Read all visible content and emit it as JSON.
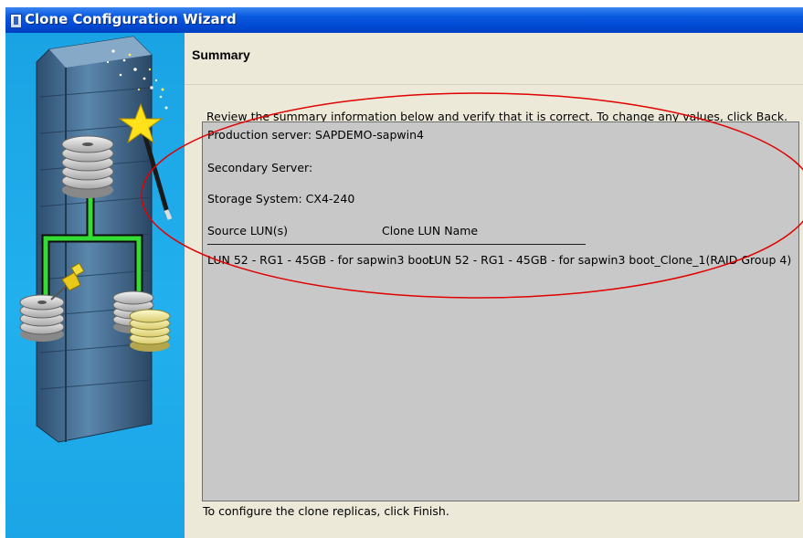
{
  "window": {
    "title": "Clone Configuration Wizard"
  },
  "header": {
    "title": "Summary"
  },
  "instructions": "Review the summary information below and verify that it is correct.  To change any values, click Back.",
  "summary": {
    "production_server": "Production server:  SAPDEMO-sapwin4",
    "secondary_server": "Secondary Server:",
    "storage_system": "Storage System:  CX4-240",
    "columns": {
      "source": "Source LUN(s)",
      "clone": "Clone LUN Name"
    },
    "rows": [
      {
        "source": "LUN 52 - RG1 - 45GB - for sapwin3 boot",
        "clone": "LUN 52 - RG1 - 45GB - for sapwin3 boot_Clone_1(RAID Group 4)"
      }
    ]
  },
  "footer": "To configure the clone replicas, click Finish.",
  "colors": {
    "title_bar": "#0049d2",
    "sidebar": "#1aa3e4",
    "summary_bg": "#c8c8c8",
    "annotation": "#e00000"
  },
  "icons": [
    "wizard-icon",
    "storage-tower-icon",
    "disk-stack-icon",
    "magic-wand-icon",
    "push-pin-icon"
  ]
}
